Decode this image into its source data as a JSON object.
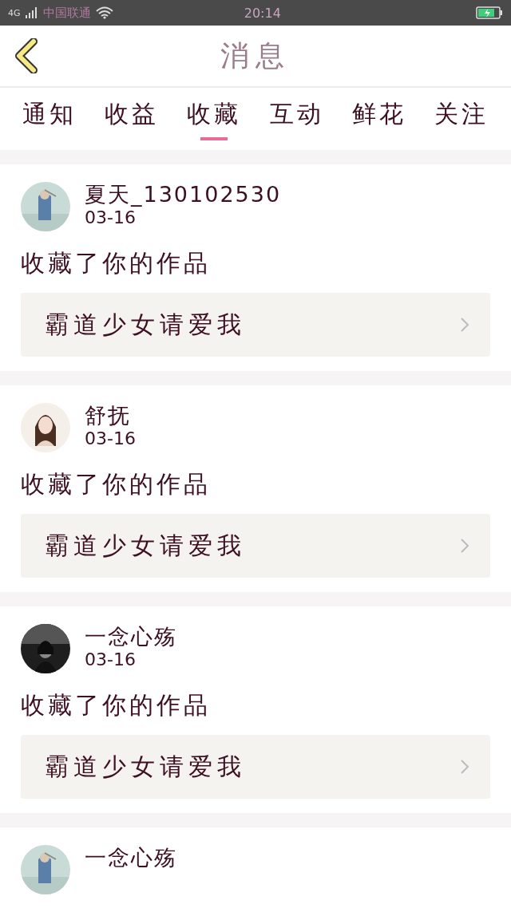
{
  "status_bar": {
    "network": "4G",
    "carrier": "中国联通",
    "time": "20:14"
  },
  "header": {
    "title": "消息"
  },
  "tabs": [
    {
      "label": "通知",
      "selected": false
    },
    {
      "label": "收益",
      "selected": false
    },
    {
      "label": "收藏",
      "selected": true
    },
    {
      "label": "互动",
      "selected": false
    },
    {
      "label": "鲜花",
      "selected": false
    },
    {
      "label": "关注",
      "selected": false
    }
  ],
  "messages": [
    {
      "name": "夏天_130102530",
      "date": "03-16",
      "action": "收藏了你的作品",
      "work": "霸道少女请爱我"
    },
    {
      "name": "舒抚",
      "date": "03-16",
      "action": "收藏了你的作品",
      "work": "霸道少女请爱我"
    },
    {
      "name": "一念心殇",
      "date": "03-16",
      "action": "收藏了你的作品",
      "work": "霸道少女请爱我"
    },
    {
      "name": "一念心殇"
    }
  ]
}
